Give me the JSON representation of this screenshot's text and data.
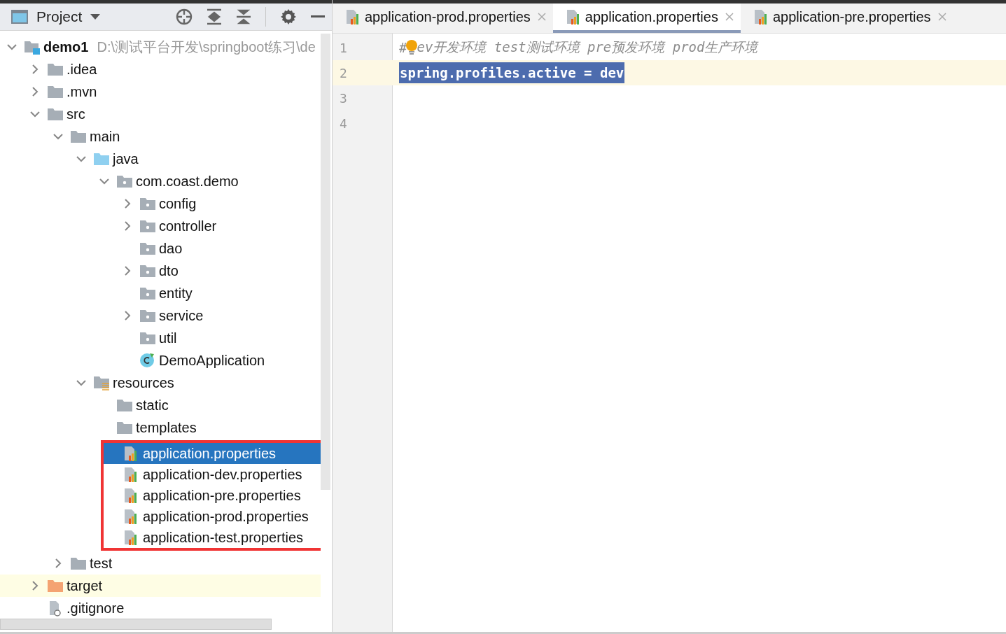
{
  "project_panel": {
    "title": "Project"
  },
  "tree": [
    {
      "name": "demo1",
      "kind": "module",
      "path": "D:\\测试平台开发\\springboot练习\\de",
      "expanded": true,
      "children": [
        {
          "name": ".idea",
          "kind": "folder",
          "expanded": false
        },
        {
          "name": ".mvn",
          "kind": "folder",
          "expanded": false
        },
        {
          "name": "src",
          "kind": "folder",
          "expanded": true,
          "children": [
            {
              "name": "main",
              "kind": "folder",
              "expanded": true,
              "children": [
                {
                  "name": "java",
                  "kind": "source",
                  "expanded": true,
                  "children": [
                    {
                      "name": "com.coast.demo",
                      "kind": "package",
                      "expanded": true,
                      "children": [
                        {
                          "name": "config",
                          "kind": "package",
                          "expanded": false
                        },
                        {
                          "name": "controller",
                          "kind": "package",
                          "expanded": false
                        },
                        {
                          "name": "dao",
                          "kind": "package"
                        },
                        {
                          "name": "dto",
                          "kind": "package",
                          "expanded": false
                        },
                        {
                          "name": "entity",
                          "kind": "package"
                        },
                        {
                          "name": "service",
                          "kind": "package",
                          "expanded": false
                        },
                        {
                          "name": "util",
                          "kind": "package"
                        },
                        {
                          "name": "DemoApplication",
                          "kind": "class"
                        }
                      ]
                    }
                  ]
                },
                {
                  "name": "resources",
                  "kind": "resources",
                  "expanded": true,
                  "children": [
                    {
                      "name": "static",
                      "kind": "folder"
                    },
                    {
                      "name": "templates",
                      "kind": "folder"
                    },
                    {
                      "name": "application.properties",
                      "kind": "properties",
                      "selected": true,
                      "boxed": true
                    },
                    {
                      "name": "application-dev.properties",
                      "kind": "properties",
                      "selected": false,
                      "boxed": true
                    },
                    {
                      "name": "application-pre.properties",
                      "kind": "properties",
                      "selected": false,
                      "boxed": true
                    },
                    {
                      "name": "application-prod.properties",
                      "kind": "properties",
                      "selected": false,
                      "boxed": true
                    },
                    {
                      "name": "application-test.properties",
                      "kind": "properties",
                      "selected": false,
                      "boxed": true
                    }
                  ]
                }
              ]
            },
            {
              "name": "test",
              "kind": "folder",
              "expanded": false
            }
          ]
        },
        {
          "name": "target",
          "kind": "excluded",
          "expanded": false,
          "highlighted": true
        },
        {
          "name": ".gitignore",
          "kind": "file"
        }
      ]
    }
  ],
  "tabs": [
    {
      "label": "application-prod.properties",
      "selected": false
    },
    {
      "label": "application.properties",
      "selected": true
    },
    {
      "label": "application-pre.properties",
      "selected": false
    }
  ],
  "editor": {
    "lines": [
      {
        "number": "1",
        "kind": "comment",
        "prefix": "#",
        "text": "ev开发环境 test测试环境 pre预发环境 prod生产环境",
        "current": false
      },
      {
        "number": "2",
        "kind": "code",
        "text": "spring.profiles.active = dev",
        "current": true,
        "selected": true
      },
      {
        "number": "3",
        "kind": "empty",
        "current": false
      },
      {
        "number": "4",
        "kind": "empty",
        "current": false
      }
    ]
  }
}
